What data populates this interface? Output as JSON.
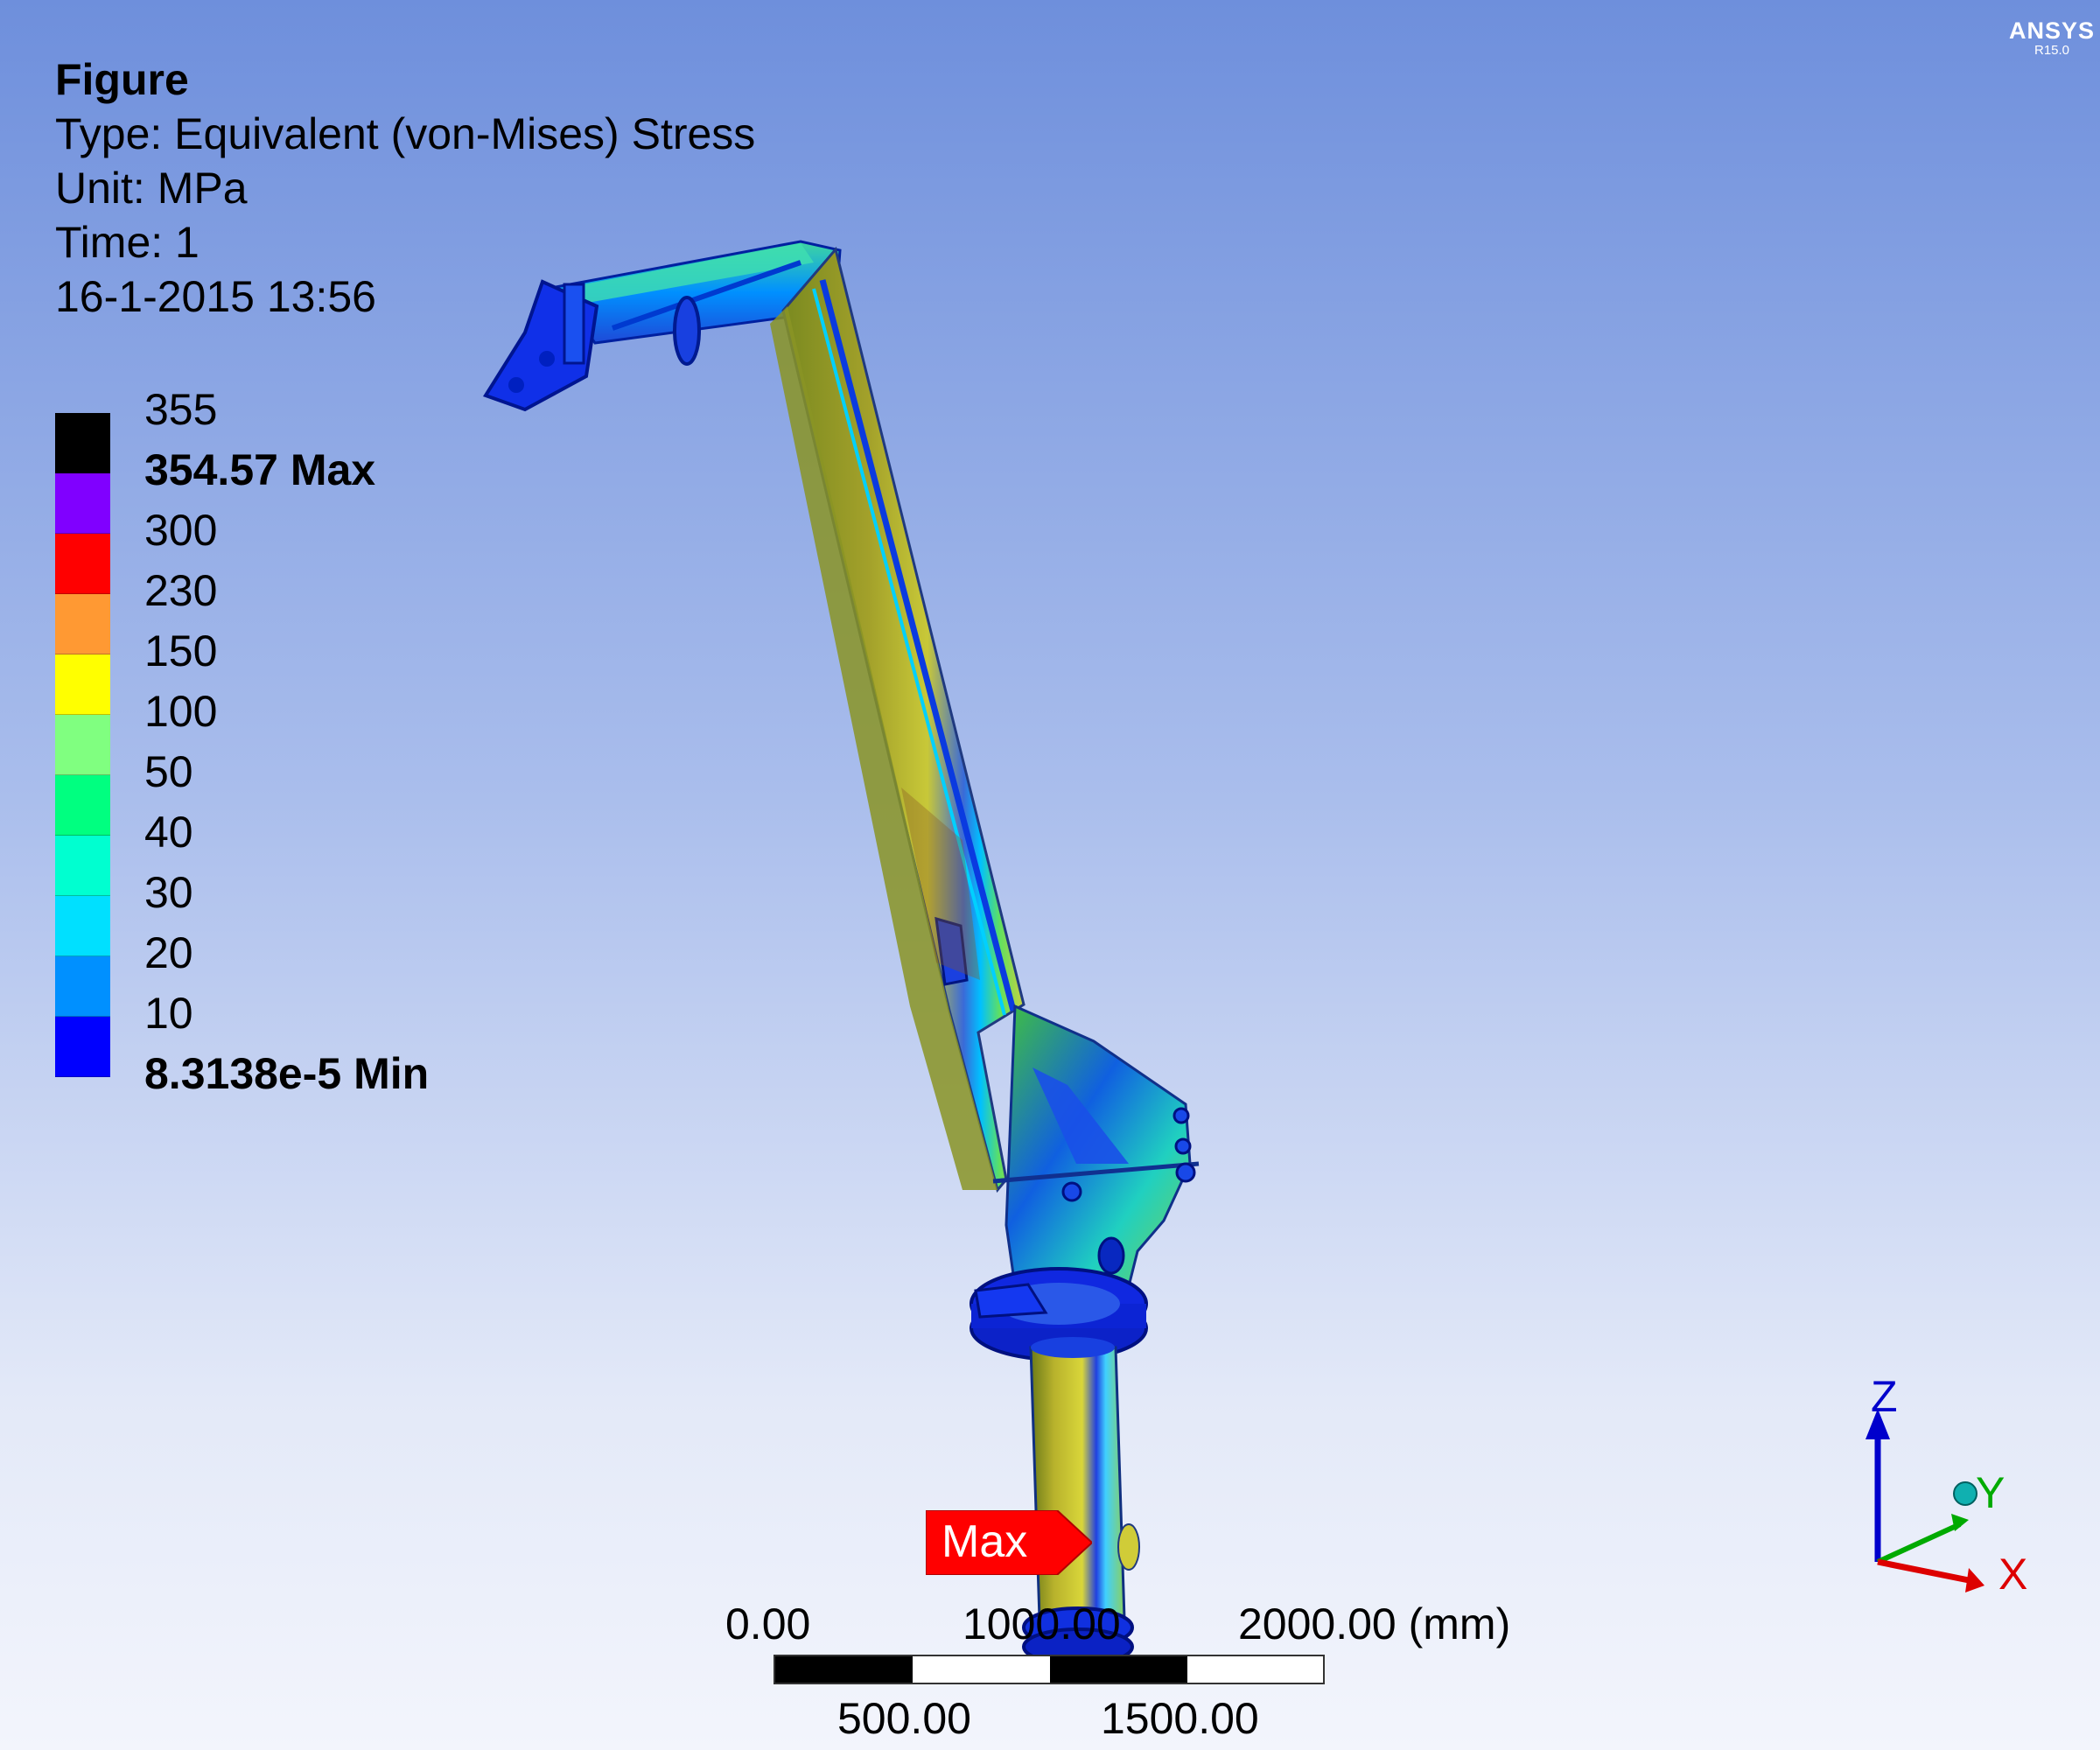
{
  "header": {
    "title": "Figure",
    "type_line": "Type: Equivalent (von-Mises) Stress",
    "unit_line": "Unit: MPa",
    "time_line": "Time: 1",
    "date_line": "16-1-2015 13:56"
  },
  "brand": {
    "name": "ANSYS",
    "version": "R15.0"
  },
  "legend": {
    "labels": [
      "355",
      "354.57 Max",
      "300",
      "230",
      "150",
      "100",
      "50",
      "40",
      "30",
      "20",
      "10",
      "8.3138e-5 Min"
    ],
    "colors": [
      "#000000",
      "#8000ff",
      "#ff0000",
      "#ff9933",
      "#ffff00",
      "#80ff80",
      "#00ff80",
      "#00ffd0",
      "#00e0ff",
      "#0090ff",
      "#0000ff"
    ]
  },
  "max_marker": {
    "label": "Max",
    "color": "#ff0000"
  },
  "scale": {
    "top_labels": [
      "0.00",
      "1000.00",
      "2000.00 (mm)"
    ],
    "bottom_labels": [
      "500.00",
      "1500.00"
    ]
  },
  "triad": {
    "z_label": "Z",
    "y_label": "Y",
    "x_label": "X",
    "z_color": "#0000cc",
    "y_color": "#00aa00",
    "x_color": "#dd0000"
  }
}
